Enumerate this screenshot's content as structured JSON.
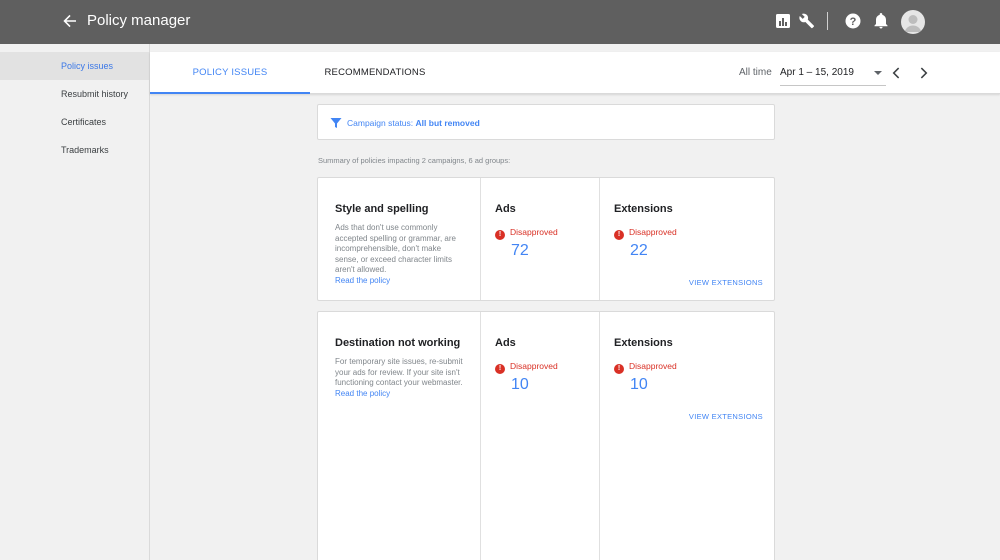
{
  "header": {
    "title": "Policy manager",
    "icons": [
      "back-arrow-icon",
      "reports-icon",
      "wrench-icon",
      "help-icon",
      "bell-icon",
      "account-icon"
    ]
  },
  "sidebar": {
    "items": [
      {
        "label": "Policy issues",
        "active": true
      },
      {
        "label": "Resubmit history",
        "active": false
      },
      {
        "label": "Certificates",
        "active": false
      },
      {
        "label": "Trademarks",
        "active": false
      }
    ]
  },
  "tabs": [
    {
      "label": "POLICY ISSUES",
      "active": true
    },
    {
      "label": "RECOMMENDATIONS",
      "active": false
    }
  ],
  "daterange": {
    "label": "All time",
    "value": "Apr 1 – 15, 2019"
  },
  "filter": {
    "label": "Campaign status:",
    "value": "All but removed"
  },
  "summary": "Summary of policies impacting 2 campaigns, 6 ad groups:",
  "cards": [
    {
      "title": "Style and spelling",
      "description": "Ads that don't use commonly accepted spelling or grammar, are incomprehensible, don't make sense, or exceed character limits aren't allowed.",
      "link": "Read the policy",
      "ads": {
        "title": "Ads",
        "status": "Disapproved",
        "count": "72"
      },
      "extensions": {
        "title": "Extensions",
        "status": "Disapproved",
        "count": "22",
        "action": "VIEW EXTENSIONS"
      }
    },
    {
      "title": "Destination not working",
      "description": "For temporary site issues, re-submit your ads for review. If your site isn't functioning contact your webmaster.",
      "link": "Read the policy",
      "ads": {
        "title": "Ads",
        "status": "Disapproved",
        "count": "10"
      },
      "extensions": {
        "title": "Extensions",
        "status": "Disapproved",
        "count": "10",
        "action": "VIEW EXTENSIONS"
      }
    }
  ],
  "colors": {
    "topbar": "#5f5f5f",
    "accent": "#4285f4",
    "error": "#d93025"
  }
}
